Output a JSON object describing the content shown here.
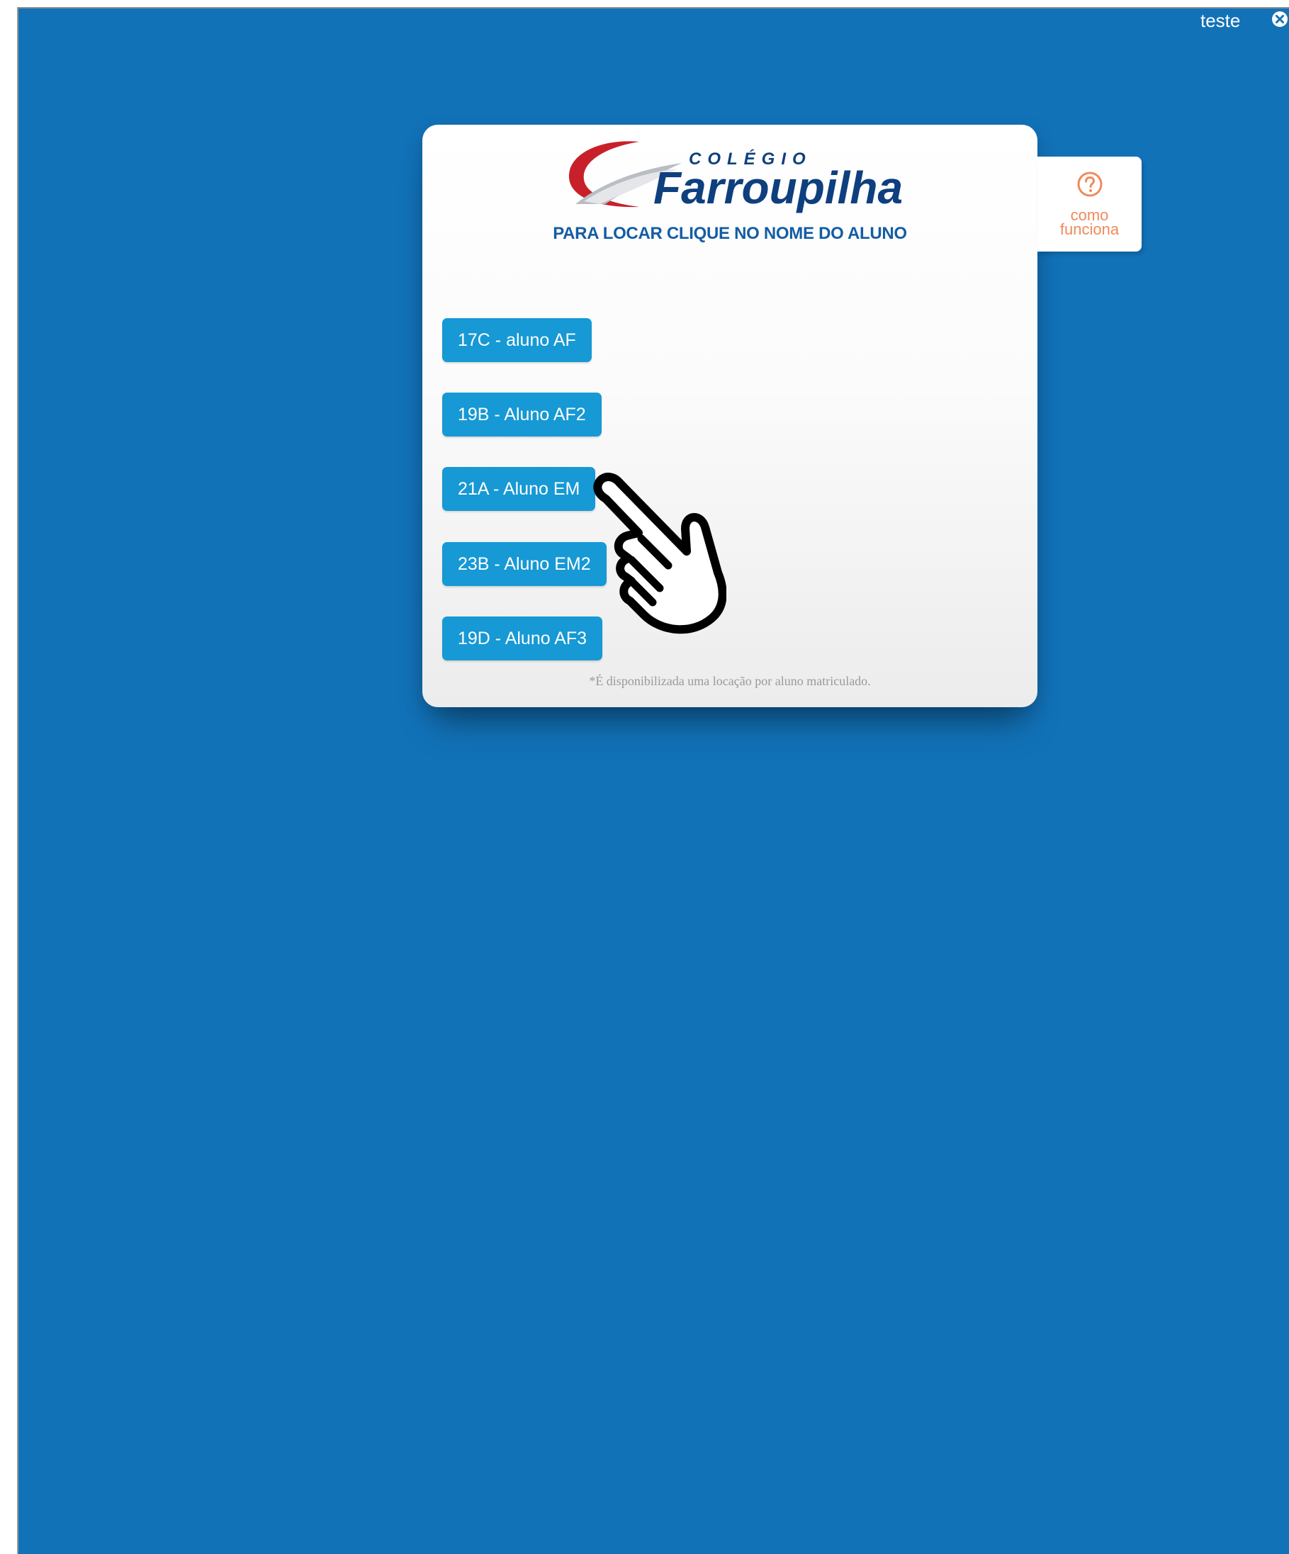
{
  "header": {
    "user_name": "teste",
    "logout_icon": "close-circle-icon"
  },
  "card": {
    "logo": {
      "top_text": "COLÉGIO",
      "brand_text": "Farroupilha"
    },
    "subtitle": "PARA LOCAR CLIQUE NO NOME DO ALUNO",
    "students": [
      {
        "label": "17C - aluno AF"
      },
      {
        "label": "19B - Aluno AF2"
      },
      {
        "label": "21A - Aluno EM"
      },
      {
        "label": "23B - Aluno EM2"
      },
      {
        "label": "19D - Aluno AF3"
      }
    ],
    "note": "*É disponibilizada uma locação por aluno matriculado."
  },
  "help": {
    "icon": "question-circle-icon",
    "line1": "como",
    "line2": "funciona"
  },
  "colors": {
    "background": "#1272b8",
    "button": "#1699d4",
    "subtitle": "#135da3",
    "help_accent": "#ef8a5c",
    "logo_red": "#c8202a"
  },
  "cursor": "hand-pointer-icon"
}
